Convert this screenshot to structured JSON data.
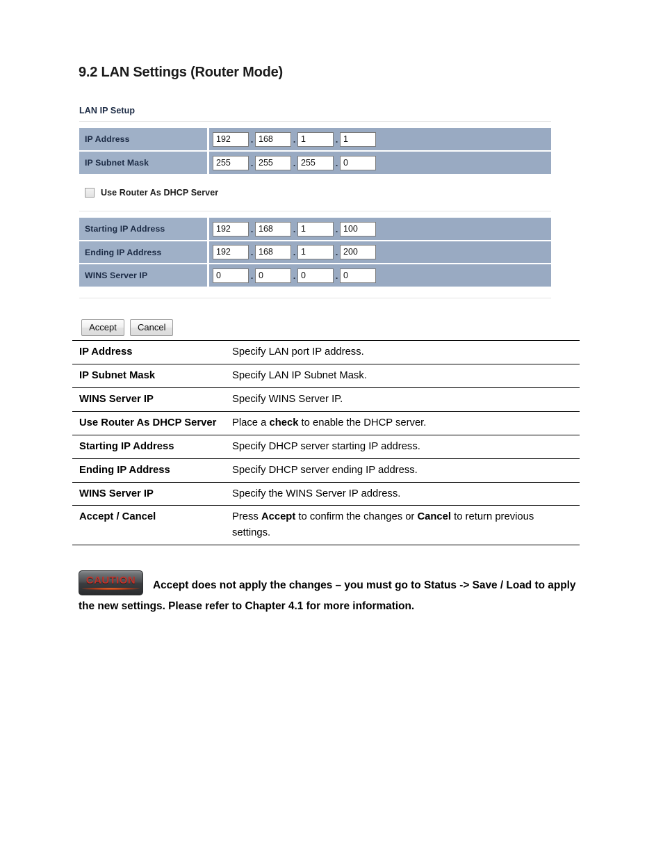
{
  "page": {
    "heading": "9.2 LAN Settings (Router Mode)"
  },
  "router_ui": {
    "panel_title": "LAN IP Setup",
    "lan_ip_rows": [
      {
        "label": "IP Address",
        "octets": [
          "192",
          "168",
          "1",
          "1"
        ],
        "dots": [
          ".",
          ".",
          "."
        ]
      },
      {
        "label": "IP Subnet Mask",
        "octets": [
          "255",
          "255",
          "255",
          "0"
        ],
        "dots": [
          ".",
          ".",
          "."
        ]
      }
    ],
    "dhcp_checkbox": {
      "label": "Use Router As DHCP Server",
      "checked": false
    },
    "dhcp_rows": [
      {
        "label": "Starting IP Address",
        "octets": [
          "192",
          "168",
          "1",
          "100"
        ],
        "dots": [
          ".",
          ".",
          "."
        ]
      },
      {
        "label": "Ending IP Address",
        "octets": [
          "192",
          "168",
          "1",
          "200"
        ],
        "dots": [
          ".",
          ".",
          "."
        ]
      },
      {
        "label": "WINS Server IP",
        "octets": [
          "0",
          "0",
          "0",
          "0"
        ],
        "dots": [
          ".",
          ".",
          "."
        ]
      }
    ],
    "buttons": {
      "accept": "Accept",
      "cancel": "Cancel"
    },
    "colors": {
      "label_cell_bg": "#9fb0c7",
      "value_cell_bg": "#99aac2",
      "label_text": "#1b2a44",
      "rule": "#e3e3e3"
    }
  },
  "doc_table": {
    "rows": [
      {
        "term": "IP Address",
        "desc_parts": [
          {
            "text": "Specify LAN port IP address.",
            "bold": false
          }
        ]
      },
      {
        "term": "IP Subnet Mask",
        "desc_parts": [
          {
            "text": "Specify LAN IP Subnet Mask.",
            "bold": false
          }
        ]
      },
      {
        "term": "WINS Server IP",
        "desc_parts": [
          {
            "text": "Specify WINS Server IP.",
            "bold": false
          }
        ]
      },
      {
        "term": "Use Router As DHCP Server",
        "desc_parts": [
          {
            "text": "Place a ",
            "bold": false
          },
          {
            "text": "check",
            "bold": true
          },
          {
            "text": " to enable the DHCP server.",
            "bold": false
          }
        ]
      },
      {
        "term": "Starting IP Address",
        "desc_parts": [
          {
            "text": "Specify DHCP server starting IP address.",
            "bold": false
          }
        ]
      },
      {
        "term": "Ending IP Address",
        "desc_parts": [
          {
            "text": "Specify DHCP server ending IP address.",
            "bold": false
          }
        ]
      },
      {
        "term": "WINS Server IP",
        "desc_parts": [
          {
            "text": "Specify the WINS Server IP address.",
            "bold": false
          }
        ]
      },
      {
        "term": "Accept / Cancel",
        "desc_parts": [
          {
            "text": "Press ",
            "bold": false
          },
          {
            "text": "Accept",
            "bold": true
          },
          {
            "text": " to confirm the changes or ",
            "bold": false
          },
          {
            "text": "Cancel",
            "bold": true
          },
          {
            "text": " to return previous settings.",
            "bold": false
          }
        ]
      }
    ]
  },
  "caution": {
    "badge_label": "CAUTION",
    "badge_text_color": "#c0332b",
    "body": "Accept does not apply the changes – you must go to Status -> Save / Load to apply the new settings. Please refer to Chapter 4.1 for more information."
  }
}
